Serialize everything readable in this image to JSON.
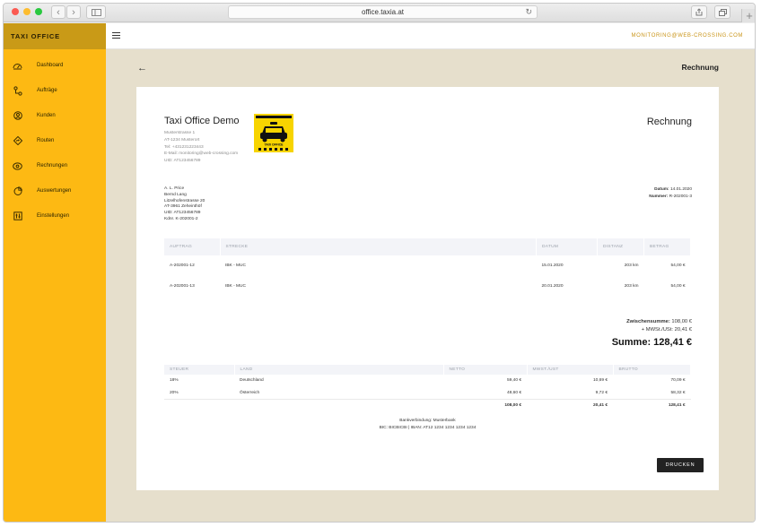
{
  "browser": {
    "url": "office.taxia.at",
    "back_symbol": "‹",
    "forward_symbol": "›",
    "reload_symbol": "↻",
    "new_tab_symbol": "+"
  },
  "app": {
    "brand": "TAXI OFFICE",
    "user_email": "MONITORING@WEB-CROSSING.COM",
    "page_title": "Rechnung",
    "accent_color": "#fdb913"
  },
  "sidebar": {
    "items": [
      {
        "label": "Dashboard",
        "icon": "dashboard-icon"
      },
      {
        "label": "Aufträge",
        "icon": "route-pin-icon"
      },
      {
        "label": "Kunden",
        "icon": "user-icon"
      },
      {
        "label": "Routen",
        "icon": "road-sign-icon"
      },
      {
        "label": "Rechnungen",
        "icon": "money-icon"
      },
      {
        "label": "Auswertungen",
        "icon": "pie-chart-icon"
      },
      {
        "label": "Einstellungen",
        "icon": "sliders-icon"
      }
    ]
  },
  "invoice": {
    "title": "Rechnung",
    "company": {
      "name": "Taxi Office Demo",
      "street": "Musterstrasse 1",
      "city": "AT-1234 Musterort",
      "phone": "Tel: +431231223443",
      "email": "E-Mail: monitoring@web-crossing.com",
      "uid": "UID: AT123456789"
    },
    "customer": {
      "line1": "A. L. Price",
      "line2": "Bernd Lang",
      "line3": "Litzelhofenstrasse 20",
      "line4": "AT-3961 Zeheinthöf",
      "line5": "UID: AT123456789",
      "line6": "Kdnr. K-202001-2"
    },
    "meta": {
      "date_label": "Datum:",
      "date_value": "14.01.2020",
      "number_label": "Nummer:",
      "number_value": "R-202001-3"
    },
    "items_headers": [
      "AUFTRAG",
      "STRECKE",
      "DATUM",
      "DISTANZ",
      "BETRAG"
    ],
    "items": [
      {
        "order": "A-202001-12",
        "route": "IBK - MUC",
        "date": "15.01.2020",
        "distance": "203 km",
        "amount": "54,00 €"
      },
      {
        "order": "A-202001-13",
        "route": "IBK - MUC",
        "date": "20.01.2020",
        "distance": "203 km",
        "amount": "54,00 €"
      }
    ],
    "totals": {
      "subtotal_label": "Zwischensumme:",
      "subtotal_value": "108,00 €",
      "vat_label": "+ MWSt./USt:",
      "vat_value": "20,41 €",
      "sum_label": "Summe:",
      "sum_value": "128,41 €"
    },
    "tax_headers": [
      "STEUER",
      "LAND",
      "NETTO",
      "MWST./UST",
      "BRUTTO"
    ],
    "tax_rows": [
      {
        "rate": "18%",
        "country": "Deutschland",
        "net": "59,40 €",
        "vat": "10,69 €",
        "gross": "70,09 €"
      },
      {
        "rate": "20%",
        "country": "Österreich",
        "net": "48,60 €",
        "vat": "9,72 €",
        "gross": "58,32 €"
      }
    ],
    "tax_sums": {
      "net": "108,00 €",
      "vat": "20,41 €",
      "gross": "128,41 €"
    },
    "bank_line1": "Bankverbindung: Musterbank",
    "bank_line2": "BIC: BICBICBI | IBAN: AT12 1234 1234 1234 1234",
    "print_label": "DRUCKEN"
  },
  "logo_text": "TAXI OFFICE"
}
